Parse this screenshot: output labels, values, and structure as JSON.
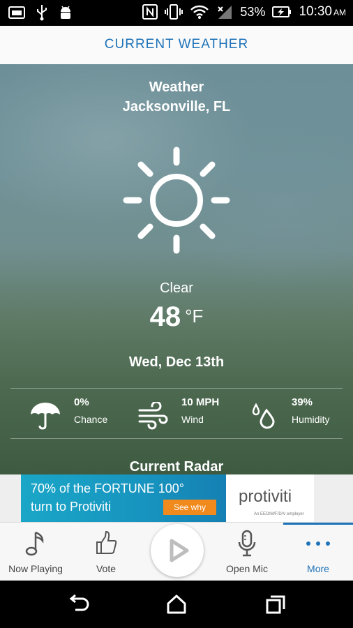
{
  "status_bar": {
    "battery": "53%",
    "time": "10:30",
    "ampm": "AM",
    "icons": [
      "image-icon",
      "usb-icon",
      "android-icon",
      "nfc-icon",
      "vibrate-icon",
      "wifi-icon",
      "signal-icon",
      "battery-charging-icon"
    ]
  },
  "header": {
    "title": "CURRENT WEATHER"
  },
  "weather": {
    "title": "Weather",
    "city": "Jacksonville, FL",
    "icon": "sun-icon",
    "condition": "Clear",
    "temperature": "48",
    "unit": "°F",
    "date": "Wed, Dec 13th",
    "stats": [
      {
        "icon": "umbrella-icon",
        "value": "0%",
        "label": "Chance"
      },
      {
        "icon": "wind-icon",
        "value": "10 MPH",
        "label": "Wind"
      },
      {
        "icon": "humidity-icon",
        "value": "39%",
        "label": "Humidity"
      }
    ],
    "radar_title": "Current Radar"
  },
  "ad": {
    "line1": "70% of the FORTUNE 100°",
    "line2": "turn to Protiviti",
    "cta": "See why",
    "brand": "protiviti",
    "tagline": "An EEO/M/F/D/V employer"
  },
  "bottom_nav": {
    "items": [
      {
        "label": "Now Playing",
        "icon": "music-note-icon"
      },
      {
        "label": "Vote",
        "icon": "thumbs-up-icon"
      },
      {
        "label": "Open Mic",
        "icon": "microphone-icon"
      },
      {
        "label": "More",
        "icon": "more-dots-icon"
      }
    ],
    "play_icon": "play-icon",
    "active": "More",
    "accent": "#1e73b8"
  },
  "system_nav": {
    "icons": [
      "back-icon",
      "home-icon",
      "recents-icon"
    ]
  }
}
